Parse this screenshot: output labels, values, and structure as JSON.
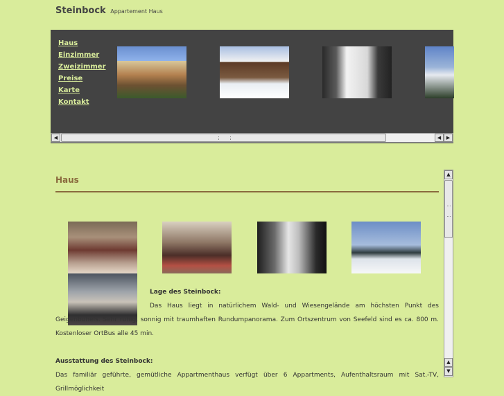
{
  "site": {
    "title": "Steinbock",
    "subtitle": "Appartement Haus"
  },
  "nav": {
    "items": [
      "Haus",
      "Einzimmer",
      "Zweizimmer",
      "Preise",
      "Karte",
      "Kontakt"
    ]
  },
  "header_gallery": {
    "images": [
      "chalet-summer-photo",
      "chalet-winter-photo",
      "chalet-snow-photo",
      "mountain-photo"
    ]
  },
  "scrollbars": {
    "left_arrow": "◀",
    "right_arrow": "▶",
    "up_arrow": "▲",
    "down_arrow": "▼"
  },
  "main": {
    "heading": "Haus",
    "gallery": [
      "living-room-photo",
      "lounge-photo",
      "snowy-forest-photo",
      "winter-meadow-photo",
      "mountain-view-photo"
    ],
    "lage_title": "Lage des Steinbock:",
    "lage_text": "Das Haus liegt in natürlichem Wald- und Wiesengelände am höchsten Punkt des Geigenbühels. Sehr ruhig, sonnig mit traumhaften Rundumpanorama. Zum Ortszentrum von Seefeld sind es ca. 800 m. Kostenloser OrtBus alle 45 min.",
    "ausstattung_title": "Ausstattung des Steinbock:",
    "ausstattung_text": "Das familiär geführte, gemütliche Appartmenthaus verfügt über 6 Appartments, Aufenthaltsraum mit Sat.-TV, Grillmöglichkeit"
  },
  "colors": {
    "background": "#d9ec9b",
    "header_panel": "#434343",
    "accent": "#8a6a3e"
  }
}
